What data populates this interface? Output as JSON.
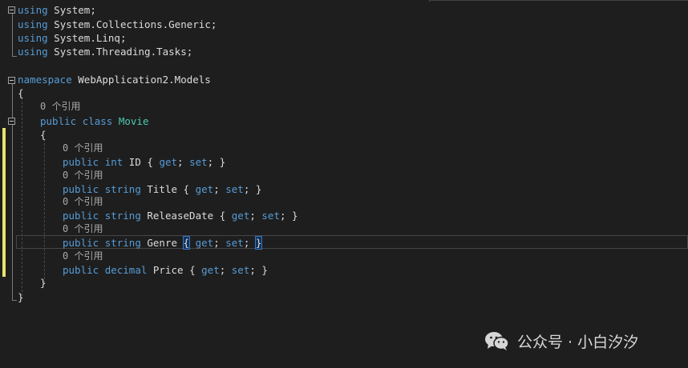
{
  "editor": {
    "language": "C#",
    "colors": {
      "background": "#1e1e1e",
      "keyword": "#569cd6",
      "type": "#4ec9b0",
      "text": "#dcdcdc",
      "codelens": "#a8a8a8",
      "change_bar": "#e8e36e"
    },
    "lines": {
      "using_1": {
        "kw": "using",
        "ns": "System;"
      },
      "using_2": {
        "kw": "using",
        "ns": "System.Collections.Generic;"
      },
      "using_3": {
        "kw": "using",
        "ns": "System.Linq;"
      },
      "using_4": {
        "kw": "using",
        "ns": "System.Threading.Tasks;"
      },
      "namespace_decl": {
        "kw": "namespace",
        "name": "WebApplication2.Models"
      },
      "open_brace_ns": "{",
      "lens_class": "0 个引用",
      "class_decl": {
        "kw1": "public",
        "kw2": "class",
        "name": "Movie"
      },
      "open_brace_class": "{",
      "properties": [
        {
          "lens": "0 个引用",
          "access": "public",
          "type": "int",
          "name": "ID",
          "open": "{",
          "get": "get",
          "set": "set",
          "close": "}"
        },
        {
          "lens": "0 个引用",
          "access": "public",
          "type": "string",
          "name": "Title",
          "open": "{",
          "get": "get",
          "set": "set",
          "close": "}"
        },
        {
          "lens": "0 个引用",
          "access": "public",
          "type": "string",
          "name": "ReleaseDate",
          "open": "{",
          "get": "get",
          "set": "set",
          "close": "}"
        },
        {
          "lens": "0 个引用",
          "access": "public",
          "type": "string",
          "name": "Genre",
          "open": "{",
          "get": "get",
          "set": "set",
          "close": "}"
        },
        {
          "lens": "0 个引用",
          "access": "public",
          "type": "decimal",
          "name": "Price",
          "open": "{",
          "get": "get",
          "set": "set",
          "close": "}"
        }
      ],
      "close_brace_class": "}",
      "close_brace_ns": "}"
    }
  },
  "watermark": {
    "icon": "wechat-icon",
    "text": "公众号 · 小白汐汐"
  }
}
